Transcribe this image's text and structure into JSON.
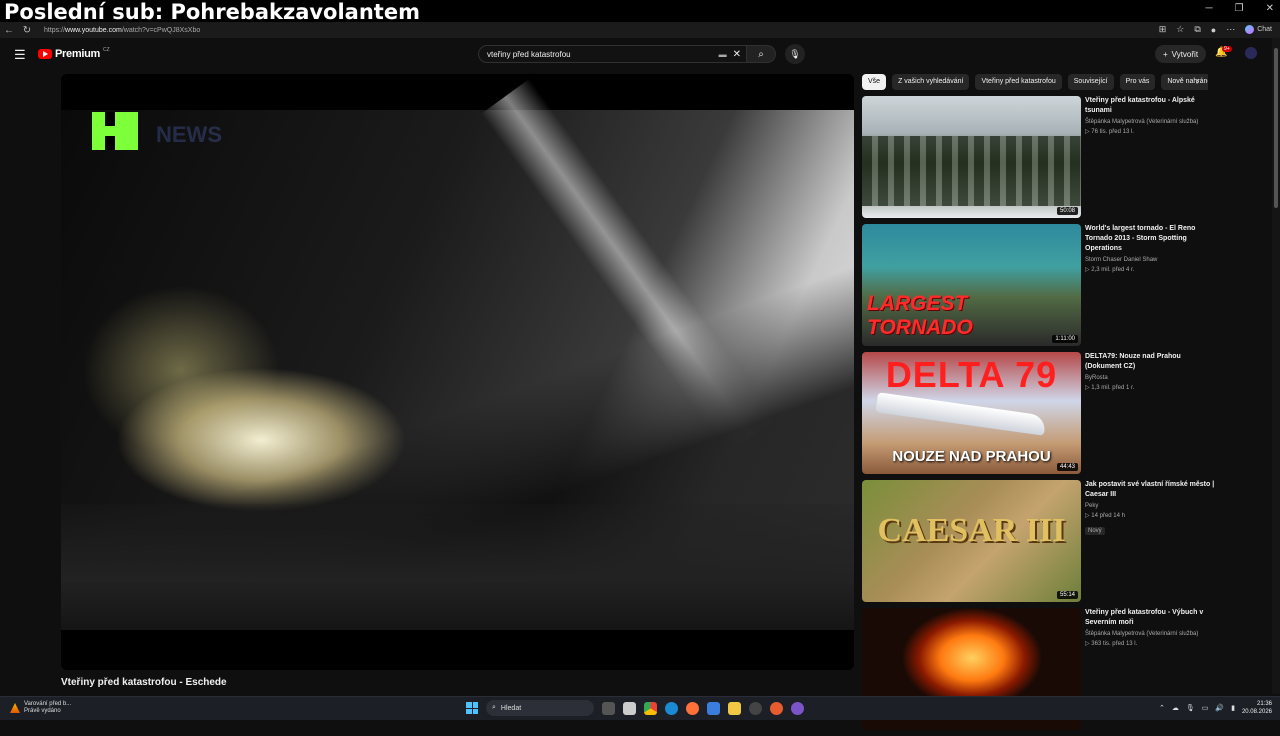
{
  "overlay": {
    "title": "Poslední sub: Pohrebakzavolantem"
  },
  "browser": {
    "url_prefix": "https://",
    "url_domain": "www.youtube.com",
    "url_path": "/watch?v=cPwQJ8XsXbo",
    "chat_label": "Chat"
  },
  "masthead": {
    "logo_text": "Premium",
    "logo_region": "CZ",
    "search_value": "vteřiny před katastrofou",
    "create_label": "Vytvořit",
    "notif_badge": "9+"
  },
  "video": {
    "title": "Vteřiny před katastrofou - Eschede",
    "channel_logo_ghost": "NEWS"
  },
  "chips": [
    "Vše",
    "Z vašich vyhledávání",
    "Vteřiny před katastrofou",
    "Související",
    "Pro vás",
    "Nově nahráno"
  ],
  "recommendations": [
    {
      "title": "Vteřiny před katastrofou - Alpské tsunami",
      "channel": "Štěpánka Malypetrová (Veterinární služba)",
      "meta": "▷ 76 tis.   před 13 l.",
      "duration": "50:08"
    },
    {
      "title": "World's largest tornado - El Reno Tornado 2013 - Storm Spotting Operations",
      "channel": "Storm Chaser Daniel Shaw",
      "meta": "▷ 2,3 mil.   před 4 r.",
      "duration": "1:11:00",
      "thumb_line1": "LARGEST",
      "thumb_line2": "TORNADO"
    },
    {
      "title": "DELTA79: Nouze nad Prahou (Dokument CZ)",
      "channel": "ByRosta",
      "meta": "▷ 1,3 mil.   před 1 r.",
      "duration": "44:43",
      "thumb_big": "DELTA 79",
      "thumb_sub": "NOUZE NAD PRAHOU"
    },
    {
      "title": "Jak postavit své vlastní římské město | Caesar III",
      "channel": "Peky",
      "meta": "▷ 14   před 14 h",
      "duration": "55:14",
      "badge": "Nový",
      "thumb_big": "CAESAR III"
    },
    {
      "title": "Vteřiny před katastrofou - Výbuch v Severním moři",
      "channel": "Štěpánka Malypetrová (Veterinární služba)",
      "meta": "▷ 363 tis.   před 13 l."
    }
  ],
  "taskbar": {
    "weather_line1": "Varování před b...",
    "weather_line2": "Právě vydáno",
    "search_label": "Hledat",
    "time": "21:36",
    "date": "20.08.2026"
  }
}
